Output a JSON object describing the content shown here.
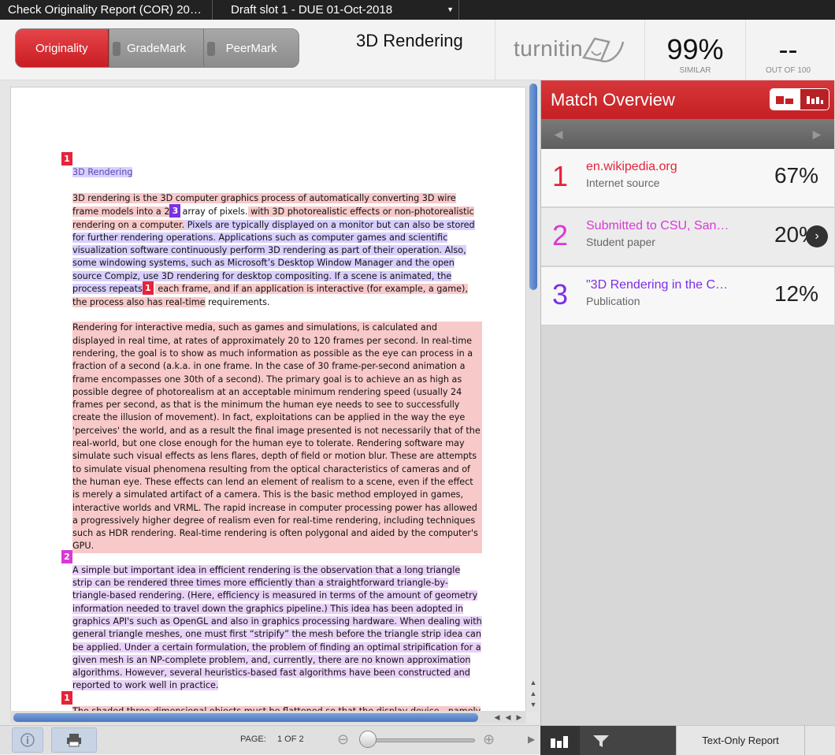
{
  "topbar": {
    "tab1": "Check Originality Report (COR) 20…",
    "tab2": "Draft slot 1 - DUE 01-Oct-2018"
  },
  "modes": [
    "Originality",
    "GradeMark",
    "PeerMark"
  ],
  "doc_title": "3D Rendering",
  "logo": "turnitin",
  "similarity": {
    "value": "99%",
    "label": "SIMILAR"
  },
  "score": {
    "value": "--",
    "label": "OUT OF 100"
  },
  "colors": {
    "match1": "#e6233a",
    "match2": "#d939d5",
    "match3": "#7d2ee5",
    "accent": "#c9262b"
  },
  "document": {
    "heading": "3D Rendering",
    "p1a": "3D rendering is the 3D computer graphics process of automatically converting 3D wire frame models into a 2",
    "p1b": "array of pixels.",
    "p1c": " with 3D photorealistic effects or non-photorealistic rendering on a computer.",
    "p1d": " Pixels are typically displayed on a monitor but can also be stored for further rendering operations. Applications such as computer games and scientific visualization software continuously perform 3D rendering as part of their operation. Also, some windowing systems, such as Microsoft’s Desktop Window Manager and the open source Compiz, use 3D rendering for desktop compositing. If a scene is animated, the process repeats",
    "p1e": " each frame, and if an application is interactive (for example, a game), the process also has",
    "p1f": " real-time",
    "p1g": " requirements.",
    "p2": "Rendering for interactive media, such as games and simulations, is calculated and displayed in real time, at rates of approximately 20 to 120 frames per second. In real-time rendering, the goal is to show as much information as possible as the eye can process in a fraction of a second (a.k.a. in one frame. In the case of 30 frame-per-second animation a frame encompasses one 30th of a second). The primary goal is to achieve an as high as possible degree of photorealism at an acceptable minimum rendering speed (usually 24 frames per second, as that is the minimum the human eye needs to see to successfully create the illusion of movement). In fact, exploitations can be applied in the way the eye 'perceives' the world, and as a result the final image presented is not necessarily that of the real-world, but one close enough for the human eye to tolerate. Rendering software may simulate such visual effects as lens flares, depth of field or motion blur. These are attempts to simulate visual phenomena resulting from the optical characteristics of cameras and of the human eye. These effects can lend an element of realism to a scene, even if the effect is merely a simulated artifact of a camera. This is the basic method employed in games, interactive worlds and VRML. The rapid increase in computer processing power has allowed a progressively higher degree of realism even for real-time rendering, including techniques such as HDR rendering. Real-time rendering is often polygonal and aided by the computer's GPU.",
    "p3": "A simple but important idea in efficient rendering is the observation that a long triangle strip can be rendered three times more efficiently than a straightforward triangle-by-triangle-based rendering. (Here, efficiency is measured in terms of the amount of geometry information needed to travel down the graphics pipeline.) This idea has been adopted in graphics API's such as OpenGL and also in graphics processing hardware. When dealing with general triangle meshes, one must first “stripify” the mesh before the triangle strip idea can be applied. Under a certain formulation, the problem of finding an optimal stripification for a given mesh is an NP-complete problem, and, currently, there are no known approximation algorithms. However, several heuristics-based fast algorithms have been constructed and reported to work well in practice.",
    "p4": "The shaded three-dimensional objects must be flattened so that the display device - namely a monitor - can display it in only two dimensions, this process is called 3D projection. This is done using projection and, for most applications, perspective projection. The basic idea behind"
  },
  "marks": {
    "m1": "1",
    "m2": "2",
    "m3": "3"
  },
  "match_overview": {
    "title": "Match Overview",
    "matches": [
      {
        "num": "1",
        "source": "en.wikipedia.org",
        "type": "Internet source",
        "pct": "67%"
      },
      {
        "num": "2",
        "source": "Submitted to CSU, San…",
        "type": "Student paper",
        "pct": "20%"
      },
      {
        "num": "3",
        "source": "\"3D Rendering in the C…",
        "type": "Publication",
        "pct": "12%"
      }
    ]
  },
  "bottom": {
    "page_label": "PAGE:",
    "page_value": "1 OF 2",
    "text_only": "Text-Only Report"
  },
  "icons": [
    "info-icon",
    "print-icon",
    "zoom-out-icon",
    "zoom-in-icon",
    "bar-chart-icon",
    "filter-icon",
    "chevron-right-icon"
  ]
}
